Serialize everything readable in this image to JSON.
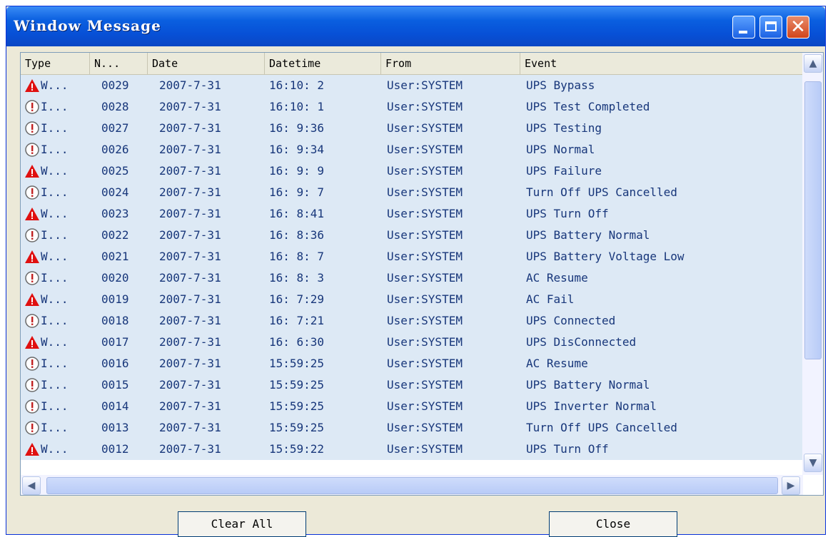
{
  "window": {
    "title": "Window Message"
  },
  "columns": [
    {
      "label": "Type"
    },
    {
      "label": "N..."
    },
    {
      "label": "Date"
    },
    {
      "label": "Datetime"
    },
    {
      "label": "From"
    },
    {
      "label": "Event"
    }
  ],
  "rows": [
    {
      "icon": "warning-icon",
      "type": "W...",
      "num": "0029",
      "date": "2007-7-31",
      "time": "16:10: 2",
      "from": "User:SYSTEM",
      "event": "UPS Bypass"
    },
    {
      "icon": "info-icon",
      "type": "I...",
      "num": "0028",
      "date": "2007-7-31",
      "time": "16:10: 1",
      "from": "User:SYSTEM",
      "event": "UPS Test Completed"
    },
    {
      "icon": "info-icon",
      "type": "I...",
      "num": "0027",
      "date": "2007-7-31",
      "time": "16: 9:36",
      "from": "User:SYSTEM",
      "event": "UPS Testing"
    },
    {
      "icon": "info-icon",
      "type": "I...",
      "num": "0026",
      "date": "2007-7-31",
      "time": "16: 9:34",
      "from": "User:SYSTEM",
      "event": "UPS Normal"
    },
    {
      "icon": "warning-icon",
      "type": "W...",
      "num": "0025",
      "date": "2007-7-31",
      "time": "16: 9: 9",
      "from": "User:SYSTEM",
      "event": "UPS Failure"
    },
    {
      "icon": "info-icon",
      "type": "I...",
      "num": "0024",
      "date": "2007-7-31",
      "time": "16: 9: 7",
      "from": "User:SYSTEM",
      "event": "Turn Off UPS Cancelled"
    },
    {
      "icon": "warning-icon",
      "type": "W...",
      "num": "0023",
      "date": "2007-7-31",
      "time": "16: 8:41",
      "from": "User:SYSTEM",
      "event": "UPS Turn Off"
    },
    {
      "icon": "info-icon",
      "type": "I...",
      "num": "0022",
      "date": "2007-7-31",
      "time": "16: 8:36",
      "from": "User:SYSTEM",
      "event": "UPS Battery Normal"
    },
    {
      "icon": "warning-icon",
      "type": "W...",
      "num": "0021",
      "date": "2007-7-31",
      "time": "16: 8: 7",
      "from": "User:SYSTEM",
      "event": "UPS Battery Voltage Low"
    },
    {
      "icon": "info-icon",
      "type": "I...",
      "num": "0020",
      "date": "2007-7-31",
      "time": "16: 8: 3",
      "from": "User:SYSTEM",
      "event": "AC Resume"
    },
    {
      "icon": "warning-icon",
      "type": "W...",
      "num": "0019",
      "date": "2007-7-31",
      "time": "16: 7:29",
      "from": "User:SYSTEM",
      "event": "AC Fail"
    },
    {
      "icon": "info-icon",
      "type": "I...",
      "num": "0018",
      "date": "2007-7-31",
      "time": "16: 7:21",
      "from": "User:SYSTEM",
      "event": "UPS Connected"
    },
    {
      "icon": "warning-icon",
      "type": "W...",
      "num": "0017",
      "date": "2007-7-31",
      "time": "16: 6:30",
      "from": "User:SYSTEM",
      "event": "UPS DisConnected"
    },
    {
      "icon": "info-icon",
      "type": "I...",
      "num": "0016",
      "date": "2007-7-31",
      "time": "15:59:25",
      "from": "User:SYSTEM",
      "event": "AC Resume"
    },
    {
      "icon": "info-icon",
      "type": "I...",
      "num": "0015",
      "date": "2007-7-31",
      "time": "15:59:25",
      "from": "User:SYSTEM",
      "event": "UPS Battery Normal"
    },
    {
      "icon": "info-icon",
      "type": "I...",
      "num": "0014",
      "date": "2007-7-31",
      "time": "15:59:25",
      "from": "User:SYSTEM",
      "event": "UPS Inverter Normal"
    },
    {
      "icon": "info-icon",
      "type": "I...",
      "num": "0013",
      "date": "2007-7-31",
      "time": "15:59:25",
      "from": "User:SYSTEM",
      "event": "Turn Off UPS Cancelled"
    },
    {
      "icon": "warning-icon",
      "type": "W...",
      "num": "0012",
      "date": "2007-7-31",
      "time": "15:59:22",
      "from": "User:SYSTEM",
      "event": "UPS Turn Off"
    }
  ],
  "buttons": {
    "clear_all": "Clear All",
    "close": "Close"
  },
  "colors": {
    "row_bg": "#dde9f5",
    "text": "#17367a",
    "warning": "#e01010",
    "title_bar": "#0750d6"
  }
}
